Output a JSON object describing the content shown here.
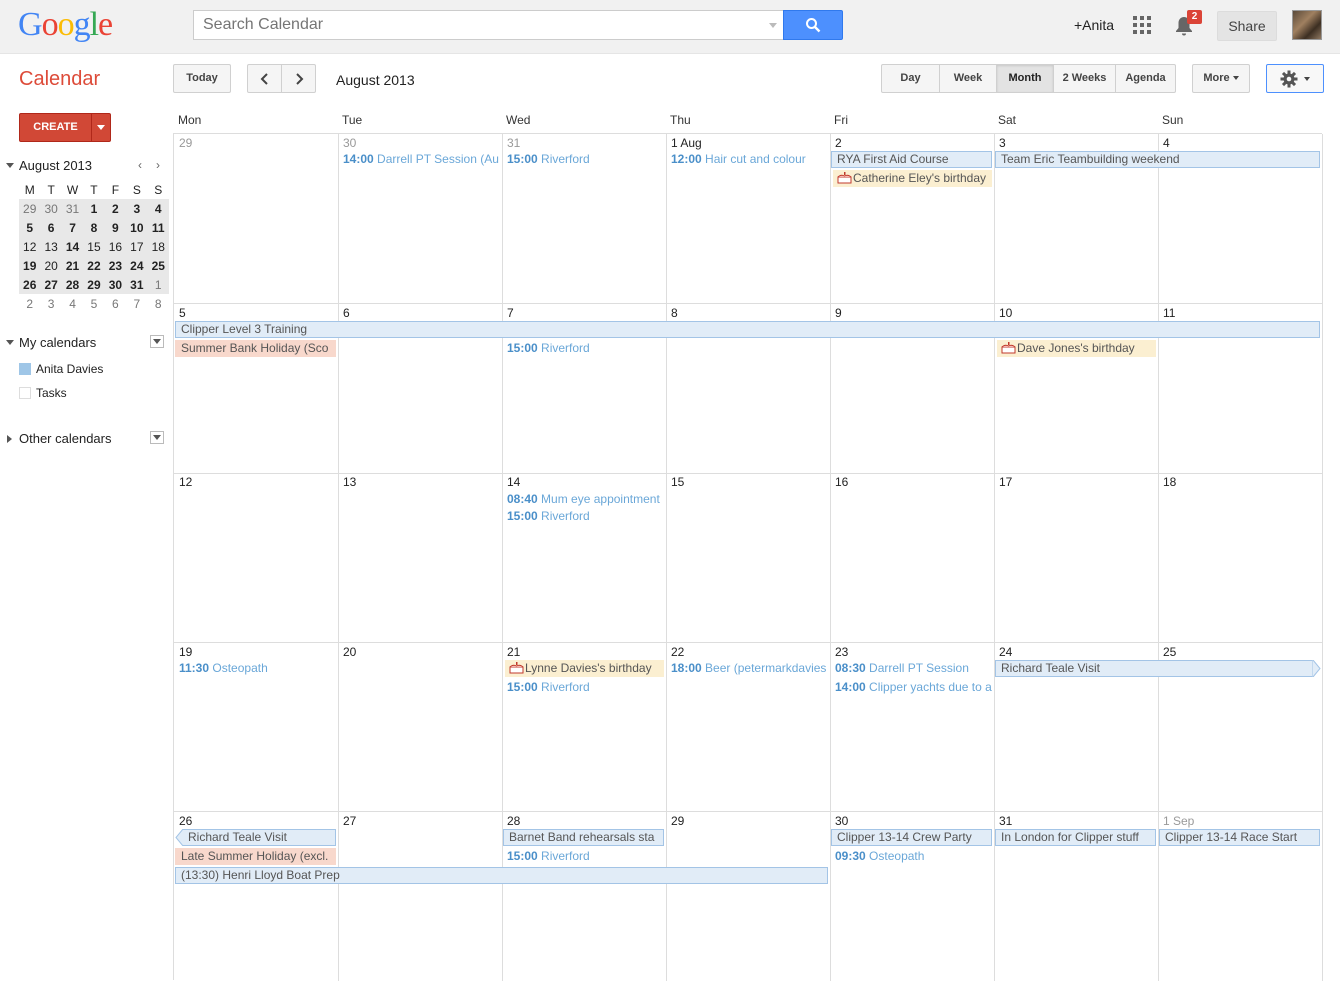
{
  "header": {
    "logo": "Google",
    "search_placeholder": "Search Calendar",
    "user": "+Anita",
    "notifications": "2",
    "share": "Share"
  },
  "toolbar": {
    "app_title": "Calendar",
    "today": "Today",
    "current_range": "August 2013",
    "views": [
      "Day",
      "Week",
      "Month",
      "2 Weeks",
      "Agenda"
    ],
    "selected_view": "Month",
    "more": "More"
  },
  "sidebar": {
    "create": "CREATE",
    "mini_month": "August 2013",
    "mini_prev": "‹",
    "mini_next": "›",
    "mini_weekdays": [
      "M",
      "T",
      "W",
      "T",
      "F",
      "S",
      "S"
    ],
    "mini_weeks": [
      [
        "29",
        "30",
        "31",
        "1",
        "2",
        "3",
        "4"
      ],
      [
        "5",
        "6",
        "7",
        "8",
        "9",
        "10",
        "11"
      ],
      [
        "12",
        "13",
        "14",
        "15",
        "16",
        "17",
        "18"
      ],
      [
        "19",
        "20",
        "21",
        "22",
        "23",
        "24",
        "25"
      ],
      [
        "26",
        "27",
        "28",
        "29",
        "30",
        "31",
        "1"
      ],
      [
        "2",
        "3",
        "4",
        "5",
        "6",
        "7",
        "8"
      ]
    ],
    "my_calendars": "My calendars",
    "calendars": [
      {
        "label": "Anita Davies",
        "color": "#9fc6e7"
      },
      {
        "label": "Tasks",
        "color": "#ffffff"
      }
    ],
    "other_calendars": "Other calendars"
  },
  "month": {
    "weekdays": [
      "Mon",
      "Tue",
      "Wed",
      "Thu",
      "Fri",
      "Sat",
      "Sun"
    ],
    "weeks": [
      [
        "29",
        "30",
        "31",
        "1 Aug",
        "2",
        "3",
        "4"
      ],
      [
        "5",
        "6",
        "7",
        "8",
        "9",
        "10",
        "11"
      ],
      [
        "12",
        "13",
        "14",
        "15",
        "16",
        "17",
        "18"
      ],
      [
        "19",
        "20",
        "21",
        "22",
        "23",
        "24",
        "25"
      ],
      [
        "26",
        "27",
        "28",
        "29",
        "30",
        "31",
        "1 Sep"
      ]
    ],
    "events": {
      "w0_tue": {
        "time": "14:00",
        "title": "Darrell PT Session (Au"
      },
      "w0_wed": {
        "time": "15:00",
        "title": "Riverford"
      },
      "w0_thu": {
        "time": "12:00",
        "title": "Hair cut and colour"
      },
      "w0_fri_bar": "RYA First Aid Course",
      "w0_fri_bday": "Catherine Eley's birthday",
      "w0_sat_bar": "Team Eric Teambuilding weekend",
      "w1_bar": "Clipper Level 3 Training",
      "w1_mon_hol": "Summer Bank Holiday (Sco",
      "w1_wed": {
        "time": "15:00",
        "title": "Riverford"
      },
      "w1_sat_bday": "Dave Jones's birthday",
      "w2_wed1": {
        "time": "08:40",
        "title": "Mum eye appointment"
      },
      "w2_wed2": {
        "time": "15:00",
        "title": "Riverford"
      },
      "w3_mon": {
        "time": "11:30",
        "title": "Osteopath"
      },
      "w3_wed_bday": "Lynne Davies's birthday",
      "w3_wed": {
        "time": "15:00",
        "title": "Riverford"
      },
      "w3_thu": {
        "time": "18:00",
        "title": "Beer (petermarkdavies"
      },
      "w3_fri1": {
        "time": "08:30",
        "title": "Darrell PT Session"
      },
      "w3_fri2": {
        "time": "14:00",
        "title": "Clipper yachts due to a"
      },
      "w3_sat_bar": "Richard Teale Visit",
      "w4_mon_bar": "Richard Teale Visit",
      "w4_mon_hol": "Late Summer Holiday (excl.",
      "w4_bar": "(13:30) Henri Lloyd Boat Prep",
      "w4_wed_bar": "Barnet Band rehearsals sta",
      "w4_wed": {
        "time": "15:00",
        "title": "Riverford"
      },
      "w4_fri_bar": "Clipper 13-14 Crew Party",
      "w4_fri": {
        "time": "09:30",
        "title": "Osteopath"
      },
      "w4_sat_bar": "In London for Clipper stuff",
      "w4_sun_bar": "Clipper 13-14 Race Start"
    }
  },
  "colors": {
    "accent_red": "#dd4b39",
    "search_blue": "#4d90fe",
    "event_blue": "#4a8fc9",
    "event_bg": "#e1ecf7"
  }
}
